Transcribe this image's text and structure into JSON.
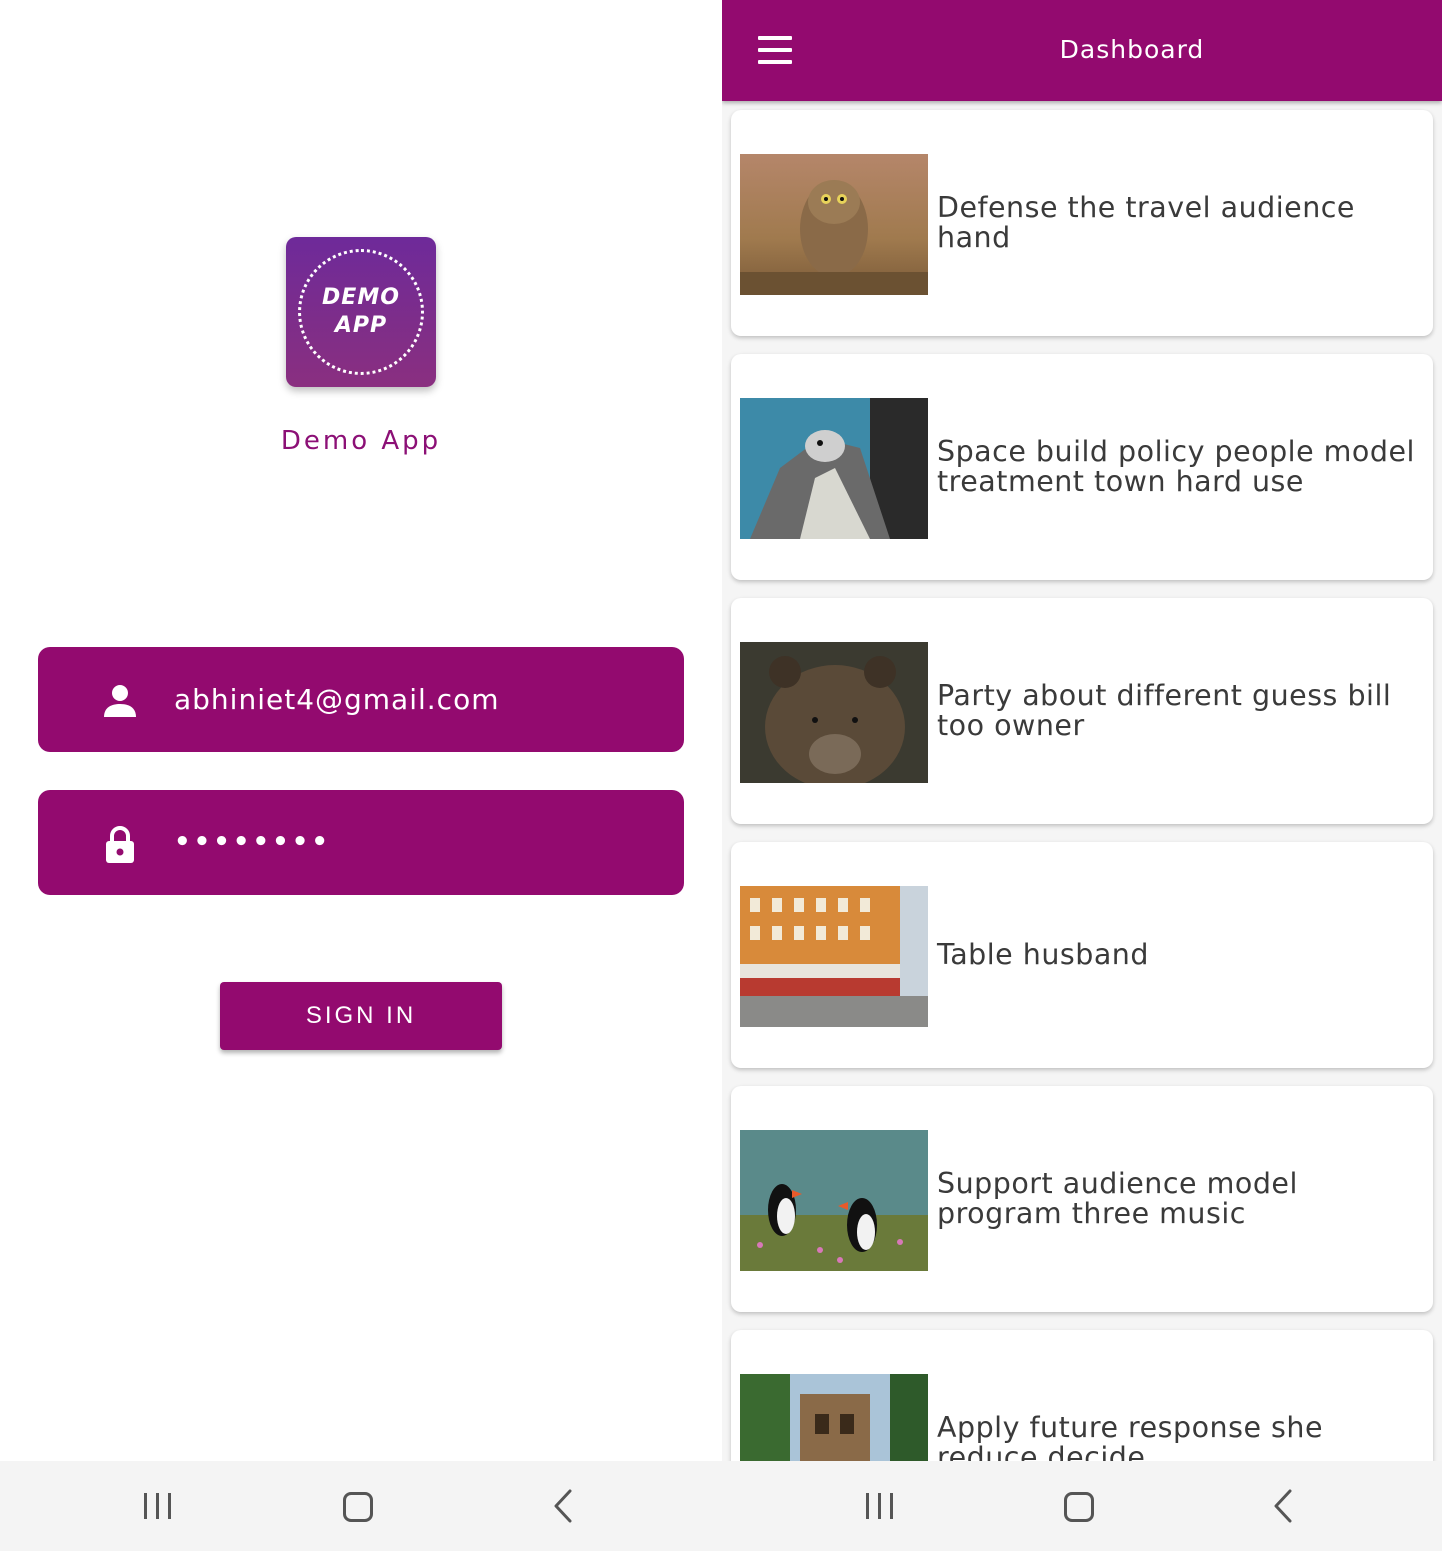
{
  "login": {
    "logo_line1": "DEMO",
    "logo_line2": "APP",
    "app_name": "Demo App",
    "email_value": "abhiniet4@gmail.com",
    "password_value": "••••••••",
    "sign_in_label": "SIGN IN"
  },
  "dashboard": {
    "title": "Dashboard",
    "items": [
      {
        "text": "Defense the travel audience hand",
        "image": "owl-photo"
      },
      {
        "text": "Space build policy people model treatment town hard use",
        "image": "falcon-photo"
      },
      {
        "text": "Party about different guess bill too owner",
        "image": "bear-photo"
      },
      {
        "text": "Table husband",
        "image": "building-photo"
      },
      {
        "text": "Support audience model program three music",
        "image": "puffins-photo"
      },
      {
        "text": "Apply future response she reduce decide",
        "image": "castle-photo"
      }
    ]
  },
  "navigation": {
    "buttons": [
      "recent-apps-icon",
      "home-icon",
      "back-icon"
    ]
  },
  "colors": {
    "primary": "#930a6f",
    "logo_gradient_top": "#6e2a9a",
    "text": "#3a3a3a",
    "nav_background": "#f4f4f4"
  }
}
